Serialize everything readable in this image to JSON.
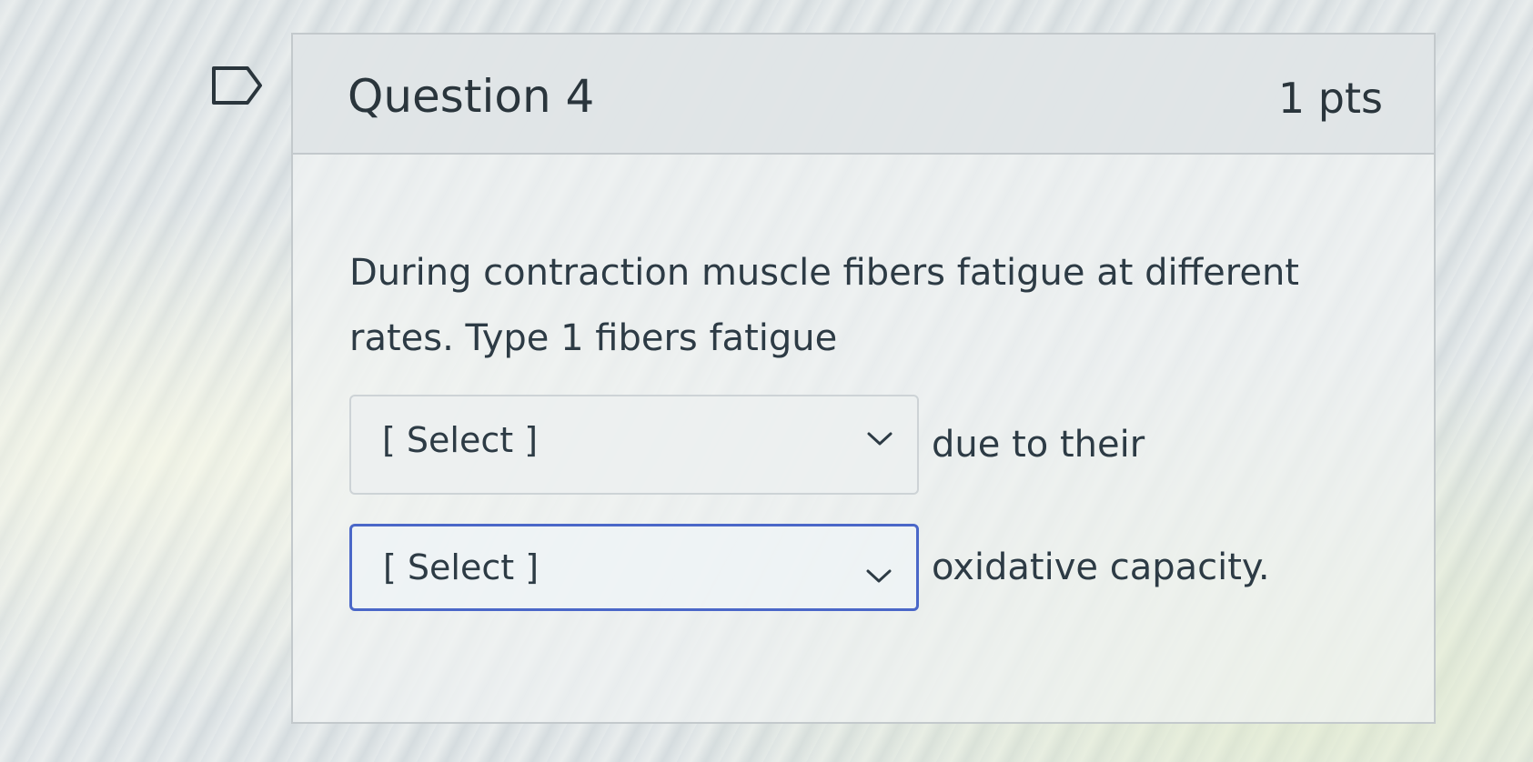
{
  "question": {
    "title": "Question 4",
    "points": "1 pts",
    "text": "During contraction muscle fibers fatigue at different rates. Type 1 fibers fatigue"
  },
  "dropdowns": [
    {
      "selected": "[ Select ]",
      "after_text": "due to their",
      "focused": false
    },
    {
      "selected": "[ Select ]",
      "after_text": "oxidative capacity.",
      "focused": true
    }
  ],
  "icons": {
    "flag": "flag-question-icon",
    "chevron": "chevron-down-icon"
  },
  "colors": {
    "focus_border": "#4a67c8",
    "text": "#2d3b45"
  }
}
